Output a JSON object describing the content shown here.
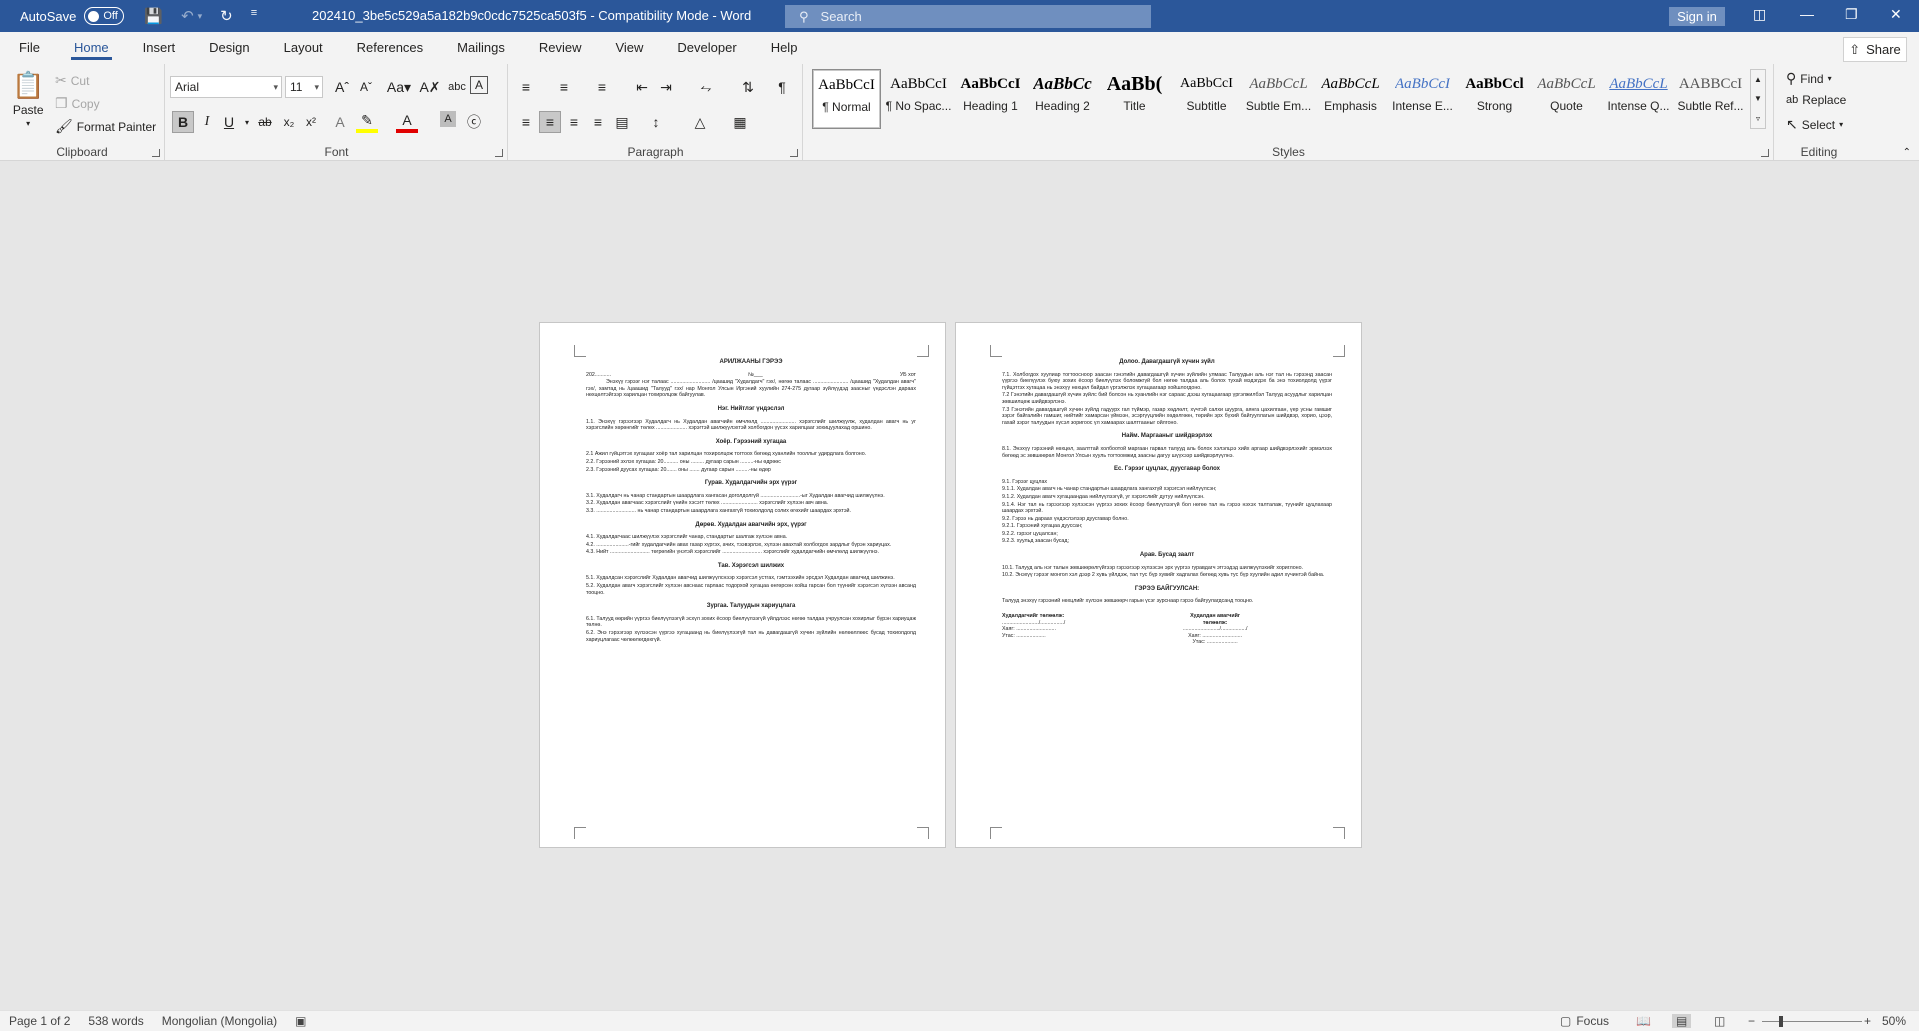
{
  "titlebar": {
    "autosave_label": "AutoSave",
    "autosave_state": "Off",
    "doc_title": "202410_3be5c529a5a182b9c0cdc7525ca503f5  -  Compatibility Mode  -  Word",
    "search_placeholder": "Search",
    "signin_label": "Sign in"
  },
  "menu": {
    "tabs": [
      "File",
      "Home",
      "Insert",
      "Design",
      "Layout",
      "References",
      "Mailings",
      "Review",
      "View",
      "Developer",
      "Help"
    ],
    "share_label": "Share"
  },
  "ribbon": {
    "clipboard": {
      "label": "Clipboard",
      "paste": "Paste",
      "cut": "Cut",
      "copy": "Copy",
      "format_painter": "Format Painter"
    },
    "font": {
      "label": "Font",
      "font_name": "Arial",
      "font_size": "11"
    },
    "paragraph": {
      "label": "Paragraph"
    },
    "styles": {
      "label": "Styles",
      "items": [
        {
          "preview": "AaBbCcI",
          "name": "¶ Normal"
        },
        {
          "preview": "AaBbCcI",
          "name": "¶ No Spac..."
        },
        {
          "preview": "AaBbCcI",
          "name": "Heading 1"
        },
        {
          "preview": "AaBbCc",
          "name": "Heading 2"
        },
        {
          "preview": "AaBb(",
          "name": "Title"
        },
        {
          "preview": "AaBbCcI",
          "name": "Subtitle"
        },
        {
          "preview": "AaBbCcL",
          "name": "Subtle Em..."
        },
        {
          "preview": "AaBbCcL",
          "name": "Emphasis"
        },
        {
          "preview": "AaBbCcI",
          "name": "Intense E..."
        },
        {
          "preview": "AaBbCcl",
          "name": "Strong"
        },
        {
          "preview": "AaBbCcL",
          "name": "Quote"
        },
        {
          "preview": "AaBbCcL",
          "name": "Intense Q..."
        },
        {
          "preview": "AABBCcI",
          "name": "Subtle Ref..."
        }
      ]
    },
    "editing": {
      "label": "Editing",
      "find": "Find",
      "replace": "Replace",
      "select": "Select"
    }
  },
  "page1": {
    "title": "АРИЛЖААНЫ ГЭРЭЭ",
    "date": "202...........",
    "number": "№___",
    "city": "УБ хот",
    "intro": "Энэхүү гэрээг нэг талаас ........................... /цаашид \"Худалдагч\" гэх/, нөгөө талаас ........................ /цаашид \"Худалдан авагч\" гэх/, хамтад нь /цаашид \"Талууд\" гэх/ нар Монгол Улсын Иргэний хуулийн 274-275 дугаар зүйлүүдэд заасныг үндэслэн дараах нөхцөлтэйгээр харилцан тохиролцож байгуулав.",
    "s1_h": "Нэг. Нийтлэг үндэслэл",
    "s1_p": "1.1. Энэхүү гэрээгээр Худалдагч нь Худалдан авагчийн өмчлөлд ........................ хэрэгслийг шилжүүлж, худалдан авагч нь уг хэрэгслийн хөрөнгийг төлөх ..................... хэрэгтэй шилжүүлэхтэй холбогдон үүсэх харилцааг зохицуулахад оршино.",
    "s2_h": "Хоёр.  Гэрээний хугацаа",
    "s2_p1": "2.1 Ажил гүйцэтгэх хугацааг хоёр тал харилцан тохиролцож тогтоох бөгөөд хуанлийн тооллыг удирдлага болгоно.",
    "s2_p2": "2.2.  Гэрээний эхлэх хугацаа: 20.......... оны ......... дугаар сарын .........-ны өдрөөс",
    "s2_p3": "2.3.  Гэрээний дуусах хугацаа: 20....... оны ....... дугаар сарын .........-ны өдөр",
    "s3_h": "Гурав.  Худалдагчийн эрх үүрэг",
    "s3_p1": "3.1. Худалдагч нь чанар стандартын шаардлага хангасан доголдолгүй ...........................-ыг Худалдан авагчид шилжүүлнэ.",
    "s3_p2": "3.2. Худалдан авагчаас хэрэгслийг үнийн хэсэгт төлөх ......................... хэрэгслийг хүлээн авч авна.",
    "s3_p3": "3.3. ........................... нь чанар стандартын шаардлага хангахгүй тохиолдолд солих өгөхийг шаардах эрхтэй.",
    "s4_h": "Дөрөв. Худалдан авагчийн эрх, үүрэг",
    "s4_p1": "4.1. Худалдагчаас шилжүүлэх хэрэгслийг чанар, стандартыг шалгаж хүлээн авна.",
    "s4_p2": "4.2. ......................-гийг худалдагчийн авах газар хүргэх, ачих, тээвэрлэх, хүлээн аваxтай холбогдох зардлыг бүрэн хариуцах.",
    "s4_p3": "4.3. Нийт ........................... төгрөгийн үнэтэй хэрэгслийг ........................... хэрэгслийг худалдагчийн өмчлөлд шилжүүлнэ.",
    "s5_h": "Тав. Хэрэгсэл шилжих",
    "s5_p1": "5.1. Худалдсан хэрэгслийг Худалдан авагчид шилжүүлснээр хэрэгсэл устгах, гэмтээхийн эрсдэл Худалдан авагчид шилжинэ.",
    "s5_p2": "5.2. Худалдан авагч хэрэгслийг хүлээн авснаас гарлаас тодорхой хугацаа өнгөрсөн хойш гарсан бол түүнийг хэрэгсэл хүлээн авсанд тооцно.",
    "s6_h": "Зургаа. Талуудын хариуцлага",
    "s6_p1": "6.1. Талууд өөрийн үүргээ биелүүлээгүй эсхүл зохих ёсоор биелүүлээгүй үйлдлээс нөгөө талдаа учруулсан хохирлыг бүрэн хариуцаж төлнө.",
    "s6_p2": "6.2. Энэ гэрээгээр хүлээсэн үүргээ хугацаанд нь биелүүлээгүй тал нь давагдашгүй хүчин зүйлийн нөлөөллөөс бусад тохиолдолд хариуцлагаас чөлөөлөгдөхгүй."
  },
  "page2": {
    "s7_h": "Долоо. Давагдашгүй хүчин зүйл",
    "s7_p1": "7.1. Холбогдох хуулиар тогтоосноор заасан гэнэтийн давагдашгүй хүчин зүйлийн улмаас Талуудын аль нэг тал нь гэрээнд заасан үүргээ биелүүлэх буюу зохих ёсоор биелүүлэх боломжгүй бол нөгөө талдаа аль болох тухай мэдэгдэх ба энэ тохиолдолд үүрэг гүйцэтгэх хугацаа нь энэхүү нөхцөл байдал үргэлжлэх хугацаагаар хойшлогдоно.",
    "s7_p2": "7.2 Гэнэтийн давагдашгүй хүчин зүйлс бий болсон нь хуанлийн нэг сараас дээш хугацаагаар үргэлжилбэл Талууд асуудлыг харилцан зөвшилцөж шийдвэрлэнэ.",
    "s7_p3": "7.3 Гэнэтийн давагдашгүй хүчин зүйлд гадуурх гал түймэр, газар хөдлөлт, хүчтэй салхи шуурга, аянга цахилгаан, үер усны гамшиг зэрэг байгалийн гамшиг, нийтийг хамарсан үймээн, эсэргүүцлийн хөдөлгөөн, төрийн эрх бүхий байгууллагын шийдвэр, хорио, цээр, гахай зэрэг талуудын хүсэл зоригоос үл хамаарах шалтгааныг ойлгоно.",
    "s8_h": "Найм. Маргааныг шийдвэрлэх",
    "s8_p1": "8.1. Энэхүү гэрээний нөхцөл, заалттай холбоотой маргаан гарвал талууд аль болох хэлэлцээ хийх аргаар шийдвэрлэхийг эрмэлзэх бөгөөд эс зөвшөөрөл Монгол Улсын хууль тогтоомжид заасны дагуу шүүхээр шийдвэрлүүлнэ.",
    "s9_h": "Ес. Гэрээг цуцлах, дуусгавар болох",
    "s9_lines": [
      "9.1. Гэрээг цуцлах",
      "9.1.1. Худалдан авагч нь чанар стандартын шаардлага хангахгүй хэрэгсэл нийлүүлсэн;",
      "9.1.2. Худалдан авагч хугацаандаа нийлүүлээгүй, уг хэрэгслийг дутуу нийлүүлсэн.",
      "9.1.4. Нэг тал нь гэрээгээр хүлээсэн үүргээ зохих ёсоор биелүүлээгүй бол нөгөө тал нь гэрээ нэхэх талталаж, түүнийг цуцлахаар шаардах эрхтэй.",
      "9.2. Гэрээ нь дараах үндэслэлээр дуусгавар болно.",
      "9.2.1. Гэрээний хугацаа дууссан;",
      "9.2.2. гэрээг цуцалсан;",
      "9.2.3. хуульд заасан бусад;"
    ],
    "s10_h": "Арав. Бусад заалт",
    "s10_p1": "10.1. Талууд аль нэг талын зөвшөөрөлгүйгээр гэрээгээр хүлээсэн эрх үүргээ гуравдагч этгээдэд шилжүүлэхийг хориглоно.",
    "s10_p2": "10.2. Энэхүү гэрээг монгол хэл дээр 2 хувь үйлдэж, тал тус бүр хувийг хадгалах бөгөөд хувь тус бүр хуулийн адил хүчинтэй байна.",
    "sign_h": "ГЭРЭЭ БАЙГУУЛСАН:",
    "sign_p": "Талууд энэхүү гэрээний нөхцлийг хүлээн зөвшөөрч гарын үсэг зурснаар гэрээ байгуулагдсанд тооцно.",
    "left_title": "Худалдагчийг төлөөлж:",
    "right_title": "Худалдан авагчийг төлөөлж:",
    "left_line1": "........................./................/",
    "right_line1": "........................./................./",
    "left_addr": "Хаяг: ...........................",
    "right_addr": "Хаяг: ...........................",
    "left_phone": "Утас: ....................",
    "right_phone": "Утас: ....................."
  },
  "status": {
    "page": "Page 1 of 2",
    "words": "538 words",
    "language": "Mongolian (Mongolia)",
    "focus": "Focus",
    "zoom": "50%"
  }
}
